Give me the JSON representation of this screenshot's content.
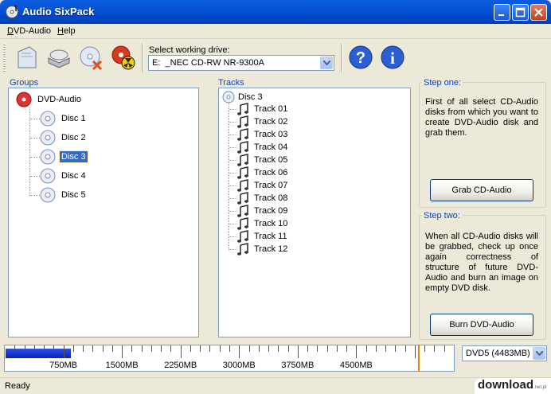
{
  "window": {
    "title": "Audio SixPack"
  },
  "menu": [
    {
      "label": "DVD-Audio",
      "accel": "D",
      "rest": "VD-Audio"
    },
    {
      "label": "Help",
      "accel": "H",
      "rest": "elp"
    }
  ],
  "toolbar": {
    "drive_label": "Select working drive:",
    "drive_value": "E:  _NEC CD-RW NR-9300A"
  },
  "groups": {
    "title": "Groups",
    "root": "DVD-Audio",
    "items": [
      "Disc 1",
      "Disc 2",
      "Disc 3",
      "Disc 4",
      "Disc 5"
    ],
    "selected": "Disc 3"
  },
  "tracks": {
    "title": "Tracks",
    "root": "Disc 3",
    "items": [
      "Track 01",
      "Track 02",
      "Track 03",
      "Track 04",
      "Track 05",
      "Track 06",
      "Track 07",
      "Track 08",
      "Track 09",
      "Track 10",
      "Track 11",
      "Track 12"
    ]
  },
  "step_one": {
    "title": "Step one:",
    "text": "First of all select CD-Audio disks from which you want to create DVD-Audio disk and grab them.",
    "button": "Grab CD-Audio"
  },
  "step_two": {
    "title": "Step two:",
    "text": "When all CD-Audio disks will be grabbed, check up once again correctness of structure of future DVD-Audio and burn an image on empty DVD disk.",
    "button": "Burn DVD-Audio"
  },
  "capacity": {
    "labels": [
      "750MB",
      "1500MB",
      "2250MB",
      "3000MB",
      "3750MB",
      "4500MB"
    ],
    "used_fraction": 0.145,
    "disc_type": "DVD5 (4483MB)"
  },
  "status": {
    "text": "Ready"
  },
  "watermark": {
    "text": "download",
    "suffix": ".net.pl"
  },
  "colors": {
    "title_bar": "#0054E3",
    "selection": "#316AC5",
    "group_label": "#0046D5",
    "fill": "#0A21B8"
  }
}
